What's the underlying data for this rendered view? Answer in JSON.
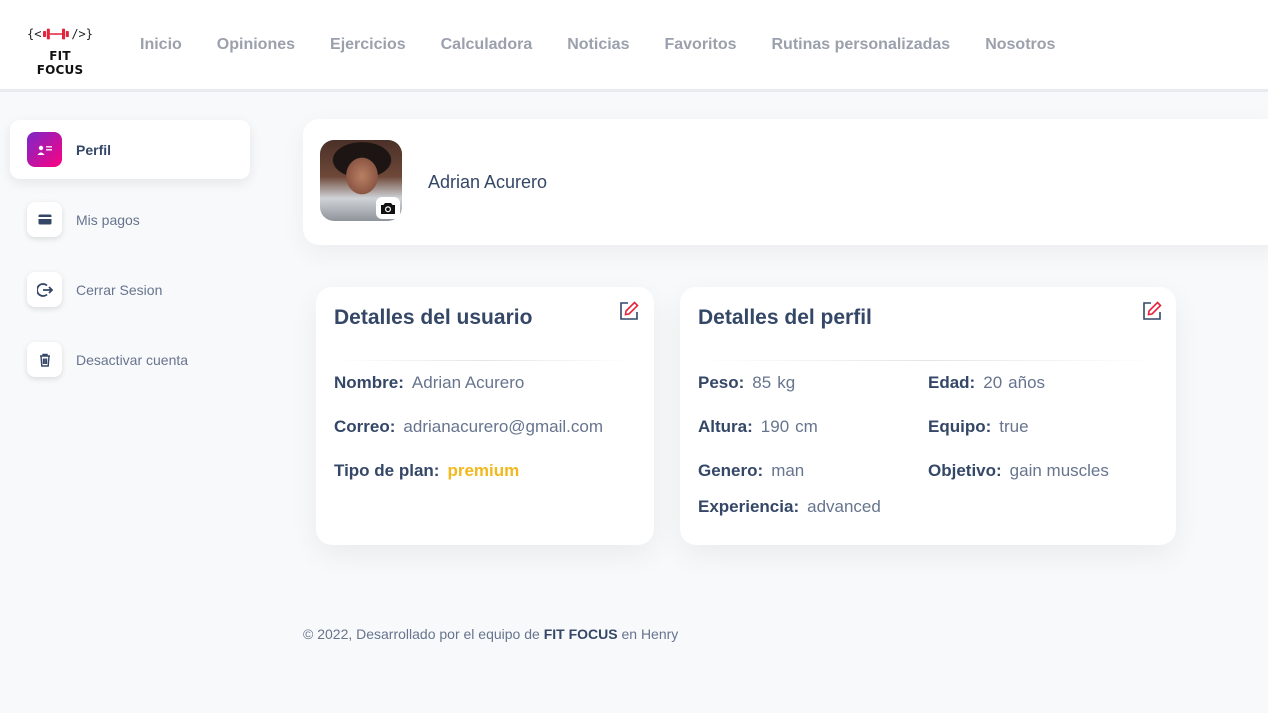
{
  "brand": {
    "logo_glyph": "{<|-|/>}",
    "name": "FIT FOCUS",
    "accent": "#e5243b"
  },
  "nav": {
    "items": [
      {
        "label": "Inicio"
      },
      {
        "label": "Opiniones"
      },
      {
        "label": "Ejercicios"
      },
      {
        "label": "Calculadora"
      },
      {
        "label": "Noticias"
      },
      {
        "label": "Favoritos"
      },
      {
        "label": "Rutinas personalizadas"
      },
      {
        "label": "Nosotros"
      }
    ]
  },
  "sidebar": {
    "items": [
      {
        "label": "Perfil",
        "icon": "profile-icon",
        "active": true
      },
      {
        "label": "Mis pagos",
        "icon": "credit-card-icon"
      },
      {
        "label": "Cerrar Sesion",
        "icon": "logout-icon"
      },
      {
        "label": "Desactivar cuenta",
        "icon": "trash-icon"
      }
    ]
  },
  "profile": {
    "name": "Adrian Acurero"
  },
  "user_details": {
    "title": "Detalles del usuario",
    "nombre_label": "Nombre:",
    "nombre": "Adrian Acurero",
    "correo_label": "Correo:",
    "correo": "adrianacurero@gmail.com",
    "plan_label": "Tipo de plan:",
    "plan": "premium",
    "plan_color": "#f1b91d"
  },
  "profile_details": {
    "title": "Detalles del perfil",
    "peso_label": "Peso:",
    "peso": "85",
    "peso_unit": "kg",
    "edad_label": "Edad:",
    "edad": "20",
    "edad_unit": "años",
    "altura_label": "Altura:",
    "altura": "190",
    "altura_unit": "cm",
    "equipo_label": "Equipo:",
    "equipo": "true",
    "genero_label": "Genero:",
    "genero": "man",
    "objetivo_label": "Objetivo:",
    "objetivo": "gain muscles",
    "experiencia_label": "Experiencia:",
    "experiencia": "advanced"
  },
  "footer": {
    "prefix": "© 2022, Desarrollado por el equipo de",
    "brand": "FIT FOCUS",
    "suffix": "en Henry"
  }
}
